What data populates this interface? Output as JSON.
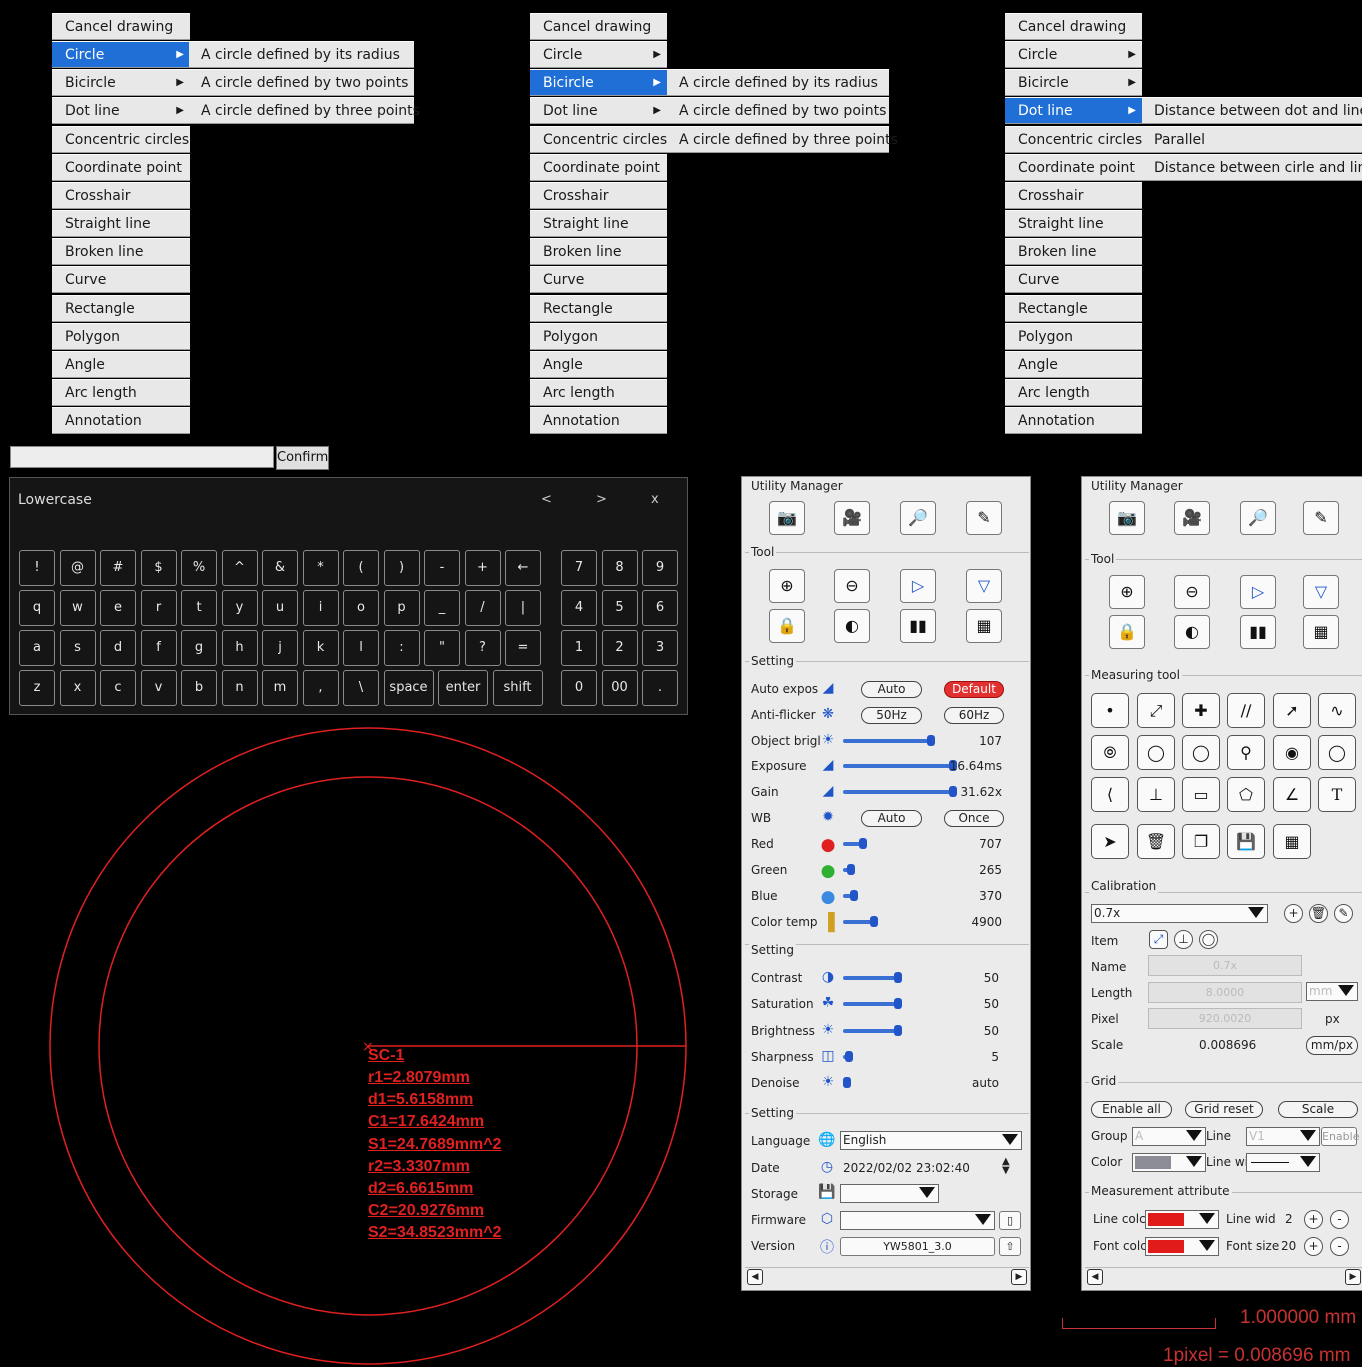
{
  "menus": [
    {
      "items": [
        "Cancel drawing",
        "Circle",
        "Bicircle",
        "Dot line",
        "Concentric circles",
        "Coordinate point",
        "Crosshair",
        "Straight line",
        "Broken line",
        "Curve",
        "Rectangle",
        "Polygon",
        "Angle",
        "Arc length",
        "Annotation"
      ],
      "selected": "Circle",
      "submenu": [
        "A circle defined by its radius",
        "A circle defined by two points",
        "A circle defined by three points"
      ]
    },
    {
      "items": [
        "Cancel drawing",
        "Circle",
        "Bicircle",
        "Dot line",
        "Concentric circles",
        "Coordinate point",
        "Crosshair",
        "Straight line",
        "Broken line",
        "Curve",
        "Rectangle",
        "Polygon",
        "Angle",
        "Arc length",
        "Annotation"
      ],
      "selected": "Bicircle",
      "submenu": [
        "A circle defined by its radius",
        "A circle defined by two points",
        "A circle defined by three points"
      ]
    },
    {
      "items": [
        "Cancel drawing",
        "Circle",
        "Bicircle",
        "Dot line",
        "Concentric circles",
        "Coordinate point",
        "Crosshair",
        "Straight line",
        "Broken line",
        "Curve",
        "Rectangle",
        "Polygon",
        "Angle",
        "Arc length",
        "Annotation"
      ],
      "selected": "Dot line",
      "submenu": [
        "Distance between dot and line",
        "Parallel",
        "Distance between cirle and line"
      ]
    }
  ],
  "keyboard": {
    "confirm_label": "Confirm",
    "title": "Lowercase",
    "prev": "<",
    "next": ">",
    "close": "x",
    "rows": [
      [
        "!",
        "@",
        "#",
        "$",
        "%",
        "^",
        "&",
        "*",
        "(",
        ")",
        "-",
        "+",
        "←"
      ],
      [
        "q",
        "w",
        "e",
        "r",
        "t",
        "y",
        "u",
        "i",
        "o",
        "p",
        "_",
        "/",
        "|"
      ],
      [
        "a",
        "s",
        "d",
        "f",
        "g",
        "h",
        "j",
        "k",
        "l",
        ":",
        "\"",
        "?",
        "="
      ],
      [
        "z",
        "x",
        "c",
        "v",
        "b",
        "n",
        "m",
        ",",
        "\\",
        "space",
        "enter",
        "shift"
      ]
    ],
    "numpad": [
      [
        "7",
        "8",
        "9"
      ],
      [
        "4",
        "5",
        "6"
      ],
      [
        "1",
        "2",
        "3"
      ],
      [
        "0",
        "00",
        "."
      ]
    ]
  },
  "measurement": {
    "label": "SC-1",
    "lines": [
      "r1=2.8079mm",
      "d1=5.6158mm",
      "C1=17.6424mm",
      "S1=24.7689mm^2",
      "r2=3.3307mm",
      "d2=6.6615mm",
      "C2=20.9276mm",
      "S2=34.8523mm^2"
    ],
    "color": "#e12020"
  },
  "panel1": {
    "title": "Utility Manager",
    "tool_title": "Tool",
    "setting1_title": "Setting",
    "setting1": {
      "auto_expos": {
        "label": "Auto expos",
        "btn1": "Auto",
        "btn2": "Default"
      },
      "anti_flicker": {
        "label": "Anti-flicker",
        "btn1": "50Hz",
        "btn2": "60Hz"
      },
      "object_bright": {
        "label": "Object brigl",
        "value": "107",
        "fraction": 0.8
      },
      "exposure": {
        "label": "Exposure",
        "value": "16.64ms",
        "fraction": 1.0
      },
      "gain": {
        "label": "Gain",
        "value": "31.62x",
        "fraction": 1.0
      },
      "wb": {
        "label": "WB",
        "btn1": "Auto",
        "btn2": "Once"
      },
      "red": {
        "label": "Red",
        "value": "707",
        "fraction": 0.18
      },
      "green": {
        "label": "Green",
        "value": "265",
        "fraction": 0.07
      },
      "blue": {
        "label": "Blue",
        "value": "370",
        "fraction": 0.1
      },
      "color_temp": {
        "label": "Color temp",
        "value": "4900",
        "fraction": 0.28
      }
    },
    "setting2_title": "Setting",
    "setting2": [
      {
        "label": "Contrast",
        "value": "50",
        "fraction": 0.5
      },
      {
        "label": "Saturation",
        "value": "50",
        "fraction": 0.5
      },
      {
        "label": "Brightness",
        "value": "50",
        "fraction": 0.5
      },
      {
        "label": "Sharpness",
        "value": "5",
        "fraction": 0.05
      },
      {
        "label": "Denoise",
        "value": "auto",
        "fraction": 0.0
      }
    ],
    "setting3_title": "Setting",
    "setting3": {
      "language_label": "Language",
      "language_value": "English",
      "date_label": "Date",
      "date_value": "2022/02/02 23:02:40",
      "storage_label": "Storage",
      "storage_value": "",
      "firmware_label": "Firmware",
      "firmware_value": "",
      "version_label": "Version",
      "version_value": "YW5801_3.0"
    }
  },
  "panel2": {
    "title": "Utility Manager",
    "tool_title": "Tool",
    "measuring_title": "Measuring tool",
    "calibration_title": "Calibration",
    "calibration": {
      "objective": "0.7x",
      "item_label": "Item",
      "name_label": "Name",
      "name_value": "0.7x",
      "length_label": "Length",
      "length_value": "8.0000",
      "length_unit": "mm",
      "pixel_label": "Pixel",
      "pixel_value": "920.0020",
      "pixel_unit": "px",
      "scale_label": "Scale",
      "scale_value": "0.008696",
      "scale_unit": "mm/px"
    },
    "grid_title": "Grid",
    "grid": {
      "enable_all": "Enable all",
      "grid_reset": "Grid reset",
      "scale": "Scale",
      "group_label": "Group",
      "group_value": "A",
      "line_label": "Line",
      "line_value": "V1",
      "enable": "Enable",
      "color_label": "Color",
      "line_wi_label": "Line wi",
      "color_value": "#8c8c96"
    },
    "attr_title": "Measurement attribute",
    "attr": {
      "line_color_label": "Line colc",
      "line_color": "#e11a1a",
      "line_width_label": "Line wid",
      "line_width_value": "2",
      "font_color_label": "Font colc",
      "font_color": "#e11a1a",
      "font_size_label": "Font size",
      "font_size_value": "20"
    }
  },
  "scale": {
    "length": "1.000000 mm",
    "pixel": "1pixel = 0.008696 mm"
  }
}
